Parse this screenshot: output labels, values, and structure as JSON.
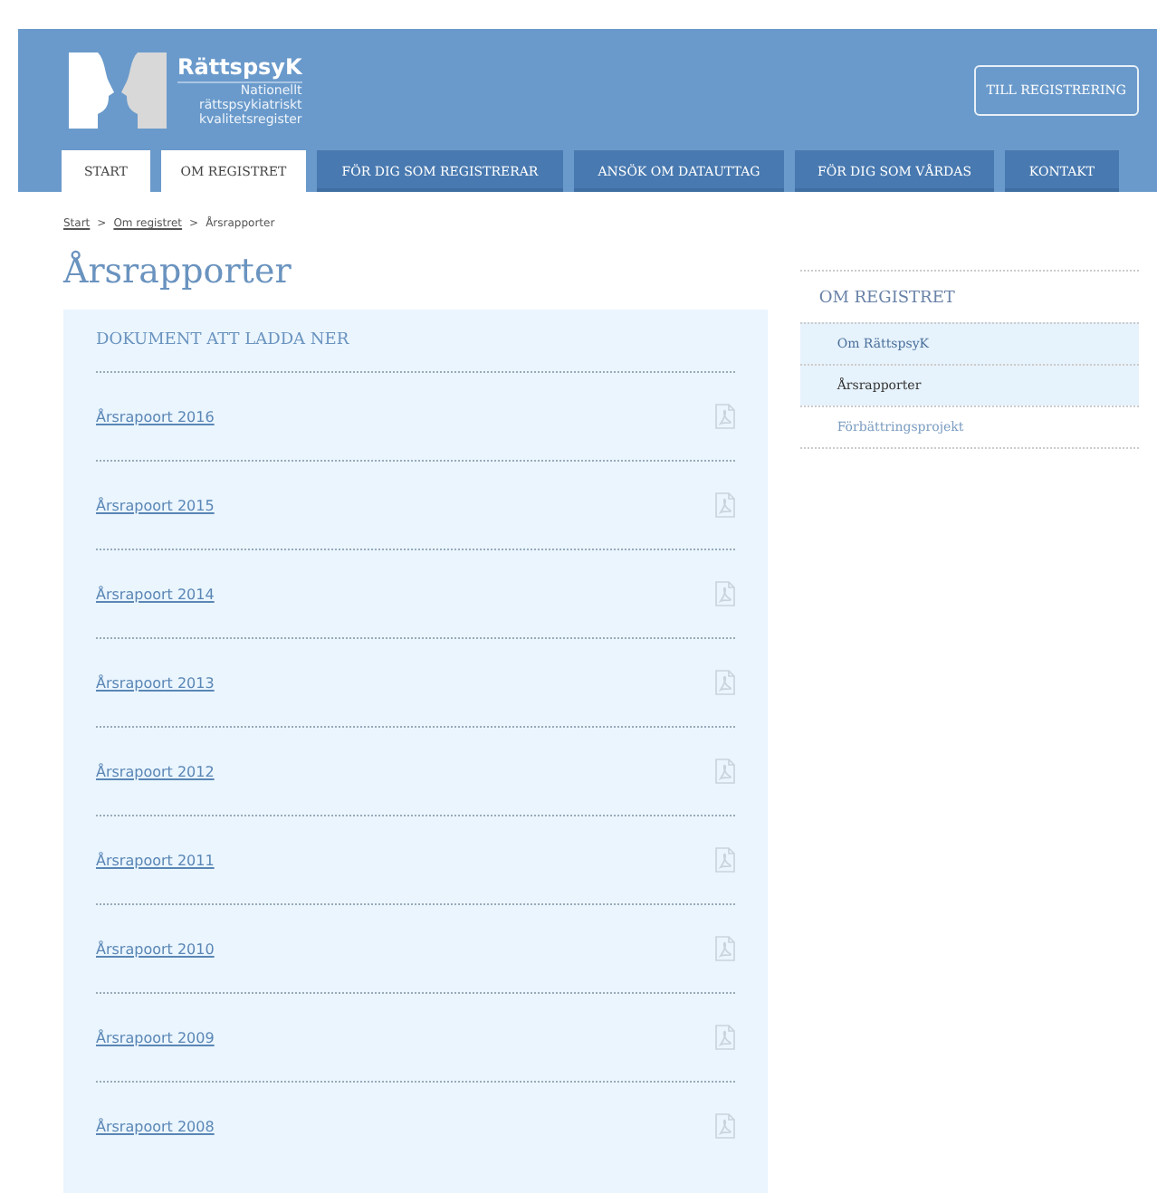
{
  "header": {
    "logo": {
      "name": "RättspsyK",
      "tagline": [
        "Nationellt",
        "rättspsykiatriskt",
        "kvalitetsregister"
      ]
    },
    "register_button": "TILL REGISTRERING"
  },
  "tabs": [
    {
      "label": "START",
      "selected": true
    },
    {
      "label": "OM REGISTRET",
      "selected": true
    },
    {
      "label": "FÖR DIG SOM REGISTRERAR",
      "selected": false
    },
    {
      "label": "ANSÖK OM DATAUTTAG",
      "selected": false
    },
    {
      "label": "FÖR DIG SOM VÅRDAS",
      "selected": false
    },
    {
      "label": "KONTAKT",
      "selected": false
    }
  ],
  "breadcrumb": [
    "Start",
    "Om registret",
    "Årsrapporter"
  ],
  "breadcrumb_separator": ">",
  "page_title": "Årsrapporter",
  "documents": {
    "heading": "DOKUMENT ATT LADDA NER",
    "items": [
      "Årsrapoort 2016",
      "Årsrapoort 2015",
      "Årsrapoort 2014",
      "Årsrapoort 2013",
      "Årsrapoort 2012",
      "Årsrapoort 2011",
      "Årsrapoort 2010",
      "Årsrapoort 2009",
      "Årsrapoort 2008"
    ]
  },
  "sidebar": {
    "heading": "OM REGISTRET",
    "items": [
      {
        "label": "Om RättspsyK",
        "kind": "section",
        "selected": false
      },
      {
        "label": "Årsrapporter",
        "kind": "section",
        "selected": true
      },
      {
        "label": "Förbättringsprojekt",
        "kind": "link",
        "selected": false
      }
    ]
  }
}
